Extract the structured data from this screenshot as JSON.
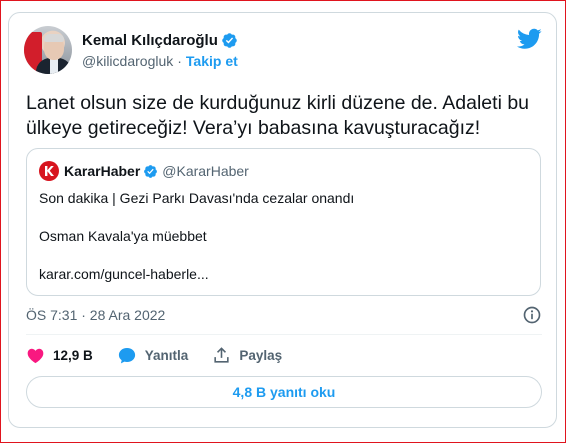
{
  "author": {
    "name": "Kemal Kılıçdaroğlu",
    "handle": "@kilicdarogluk",
    "separator": "·",
    "follow_label": "Takip et"
  },
  "tweet": {
    "text": "Lanet olsun size de kurduğunuz kirli düzene de. Adaleti bu ülkeye getireceğiz! Vera’yı babasına kavuşturacağız!",
    "timestamp": "ÖS 7:31 · 28 Ara 2022"
  },
  "quote": {
    "name": "KararHaber",
    "handle": "@KararHaber",
    "logo_letter": "K",
    "line1": "Son dakika | Gezi Parkı Davası'nda cezalar onandı",
    "line2": "Osman Kavala'ya müebbet",
    "link": "karar.com/guncel-haberle..."
  },
  "actions": {
    "likes": "12,9 B",
    "reply_label": "Yanıtla",
    "share_label": "Paylaş"
  },
  "read_replies_label": "4,8 B yanıtı oku",
  "colors": {
    "twitter_blue": "#1d9bf0",
    "like_pink": "#f91880",
    "karar_red": "#d7141e",
    "frame_red": "#e0141e"
  },
  "icons": [
    "twitter-bird-icon",
    "verified-icon",
    "info-icon",
    "heart-icon",
    "reply-icon",
    "share-icon"
  ]
}
